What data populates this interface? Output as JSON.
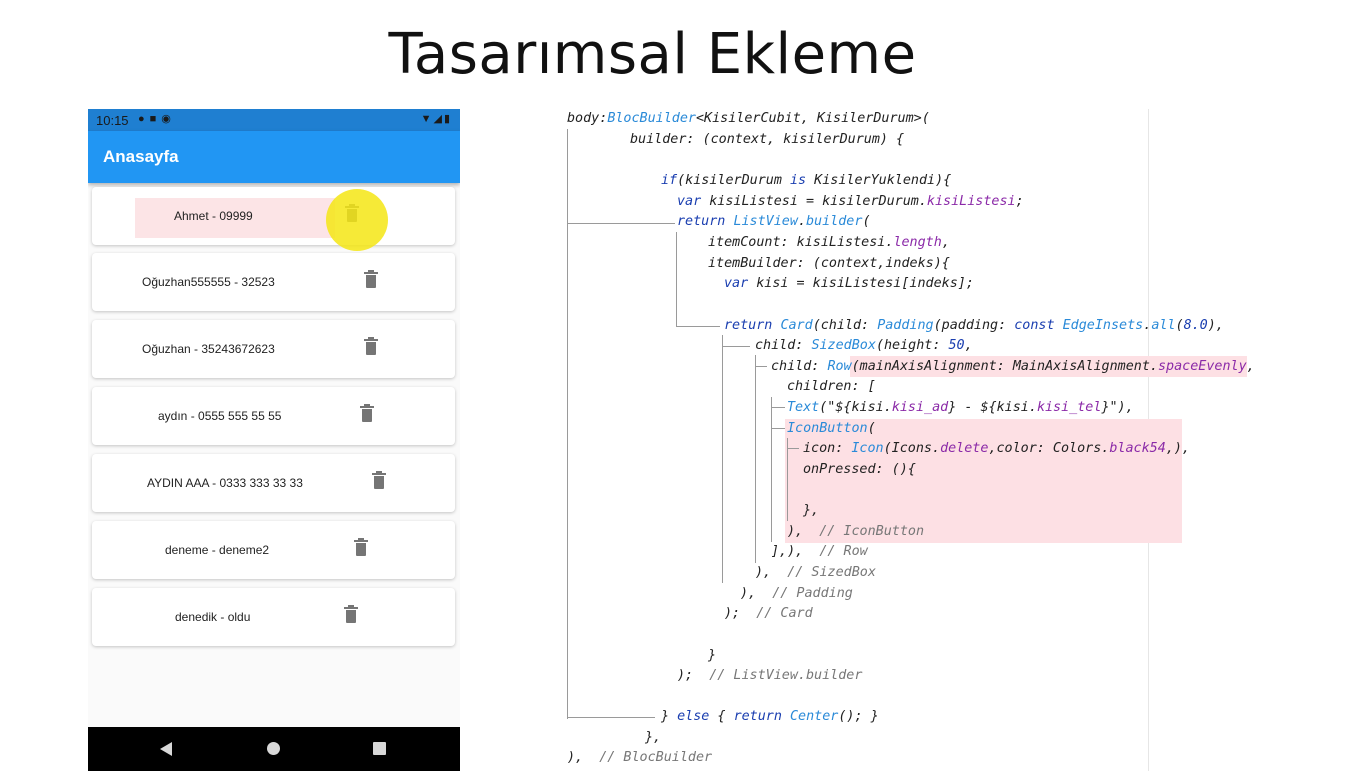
{
  "slide": {
    "title": "Tasarımsal Ekleme"
  },
  "phone": {
    "status_time": "10:15",
    "appbar_title": "Anasayfa",
    "items": [
      {
        "text": "Ahmet - 09999"
      },
      {
        "text": "Oğuzhan555555 - 32523"
      },
      {
        "text": "Oğuzhan - 35243672623"
      },
      {
        "text": "aydın - 0555 555 55 55"
      },
      {
        "text": "AYDIN AAA - 0333 333 33 33"
      },
      {
        "text": "deneme - deneme2"
      },
      {
        "text": "denedik - oldu"
      }
    ],
    "icons": {
      "status": [
        "shield-icon",
        "sim-icon",
        "at-icon"
      ],
      "status_right": [
        "wifi-icon",
        "signal-icon",
        "battery-icon"
      ],
      "delete": "trash-icon",
      "nav": [
        "back-icon",
        "home-icon",
        "recents-icon"
      ]
    }
  },
  "code": {
    "l01": [
      "body:",
      "BlocBuilder",
      "<KisilerCubit, KisilerDurum>("
    ],
    "l02": "builder: (context, kisilerDurum) {",
    "l03": [
      "if",
      "(kisilerDurum ",
      "is",
      " KisilerYuklendi){"
    ],
    "l04": [
      "var",
      " kisiListesi = kisilerDurum.",
      "kisiListesi",
      ";"
    ],
    "l05": [
      "return",
      " ",
      "ListView",
      ".",
      "builder",
      "("
    ],
    "l06": [
      "itemCount: kisiListesi.",
      "length",
      ","
    ],
    "l07": "itemBuilder: (context,indeks){",
    "l08": [
      "var",
      " kisi = kisiListesi[indeks];"
    ],
    "l09": [
      "return",
      " ",
      "Card",
      "(child: ",
      "Padding",
      "(padding: ",
      "const",
      " ",
      "EdgeInsets",
      ".",
      "all",
      "(",
      "8.0",
      "),"
    ],
    "l10": [
      "child: ",
      "SizedBox",
      "(height: ",
      "50",
      ","
    ],
    "l11": [
      "child: ",
      "Row",
      "(mainAxisAlignment: MainAxisAlignment.",
      "spaceEvenly",
      ","
    ],
    "l12": "children: [",
    "l13": [
      "Text",
      "(\"${kisi.",
      "kisi_ad",
      "} - ${kisi.",
      "kisi_tel",
      "}\"),"
    ],
    "l14": [
      "IconButton",
      "("
    ],
    "l15": [
      "icon: ",
      "Icon",
      "(Icons.",
      "delete",
      ",color: Colors.",
      "black54",
      ",),"
    ],
    "l16": "onPressed: (){",
    "l17": "},",
    "l18": [
      "),  ",
      "// IconButton"
    ],
    "l19": [
      "],),  ",
      "// Row"
    ],
    "l20": [
      "),  ",
      "// SizedBox"
    ],
    "l21": [
      "),  ",
      "// Padding"
    ],
    "l22": [
      ");  ",
      "// Card"
    ],
    "l23": "}",
    "l24": [
      ");  ",
      "// ListView.builder"
    ],
    "l25": [
      "} ",
      "else",
      " { ",
      "return",
      " ",
      "Center",
      "(); }"
    ],
    "l26": "},",
    "l27": [
      "),  ",
      "// BlocBuilder"
    ]
  },
  "colors": {
    "appbar": "#2196f3",
    "highlight": "#fde0e4",
    "keyword": "#1a3eb0",
    "type": "#2a8ad8",
    "property": "#8b2aa8"
  }
}
